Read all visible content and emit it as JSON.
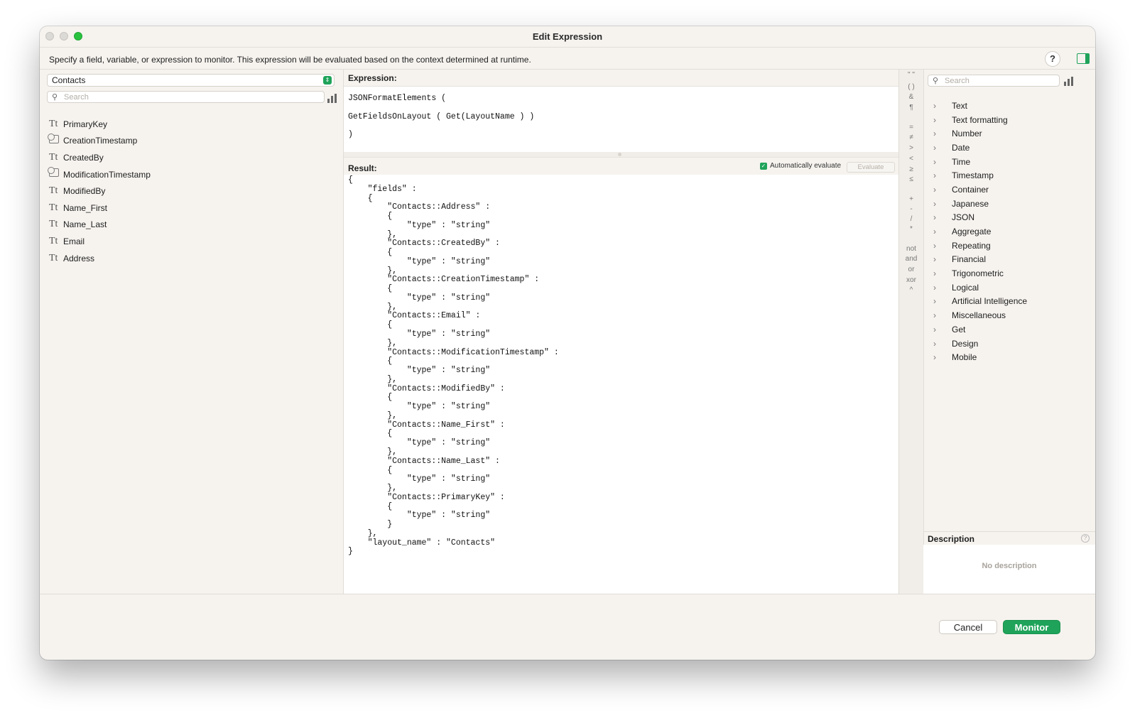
{
  "window": {
    "title": "Edit Expression",
    "instruction": "Specify a field, variable, or expression to monitor. This expression will be evaluated based on the context determined at runtime.",
    "help_label": "?"
  },
  "left": {
    "table_selected": "Contacts",
    "search_placeholder": "Search",
    "fields": [
      {
        "name": "PrimaryKey",
        "icon": "text-field-icon"
      },
      {
        "name": "CreationTimestamp",
        "icon": "timestamp-field-icon"
      },
      {
        "name": "CreatedBy",
        "icon": "text-field-icon"
      },
      {
        "name": "ModificationTimestamp",
        "icon": "timestamp-field-icon"
      },
      {
        "name": "ModifiedBy",
        "icon": "text-field-icon"
      },
      {
        "name": "Name_First",
        "icon": "text-field-icon"
      },
      {
        "name": "Name_Last",
        "icon": "text-field-icon"
      },
      {
        "name": "Email",
        "icon": "text-field-icon"
      },
      {
        "name": "Address",
        "icon": "text-field-icon"
      }
    ]
  },
  "expression": {
    "label": "Expression:",
    "text": "JSONFormatElements (\nGetFieldsOnLayout ( Get(LayoutName ) )\n)"
  },
  "result": {
    "label": "Result:",
    "auto_evaluate_label": "Automatically evaluate",
    "auto_evaluate_checked": true,
    "evaluate_label": "Evaluate",
    "text": "{\n    \"fields\" :\n    {\n        \"Contacts::Address\" :\n        {\n            \"type\" : \"string\"\n        },\n        \"Contacts::CreatedBy\" :\n        {\n            \"type\" : \"string\"\n        },\n        \"Contacts::CreationTimestamp\" :\n        {\n            \"type\" : \"string\"\n        },\n        \"Contacts::Email\" :\n        {\n            \"type\" : \"string\"\n        },\n        \"Contacts::ModificationTimestamp\" :\n        {\n            \"type\" : \"string\"\n        },\n        \"Contacts::ModifiedBy\" :\n        {\n            \"type\" : \"string\"\n        },\n        \"Contacts::Name_First\" :\n        {\n            \"type\" : \"string\"\n        },\n        \"Contacts::Name_Last\" :\n        {\n            \"type\" : \"string\"\n        },\n        \"Contacts::PrimaryKey\" :\n        {\n            \"type\" : \"string\"\n        }\n    },\n    \"layout_name\" : \"Contacts\"\n}"
  },
  "operators": {
    "quotes": "\" \"",
    "parens": "( )",
    "amp": "&",
    "pilcrow": "¶",
    "eq": "=",
    "neq": "≠",
    "gt": ">",
    "lt": "<",
    "gte": "≥",
    "lte": "≤",
    "plus": "+",
    "minus": "-",
    "div": "/",
    "mul": "*",
    "not": "not",
    "and": "and",
    "or": "or",
    "xor": "xor",
    "pow": "^"
  },
  "functions": {
    "search_placeholder": "Search",
    "categories": [
      "Text",
      "Text formatting",
      "Number",
      "Date",
      "Time",
      "Timestamp",
      "Container",
      "Japanese",
      "JSON",
      "Aggregate",
      "Repeating",
      "Financial",
      "Trigonometric",
      "Logical",
      "Artificial Intelligence",
      "Miscellaneous",
      "Get",
      "Design",
      "Mobile"
    ]
  },
  "description": {
    "label": "Description",
    "empty_text": "No description"
  },
  "buttons": {
    "cancel": "Cancel",
    "monitor": "Monitor"
  },
  "colors": {
    "accent": "#1fa35a",
    "window_bg": "#f6f3ef"
  }
}
